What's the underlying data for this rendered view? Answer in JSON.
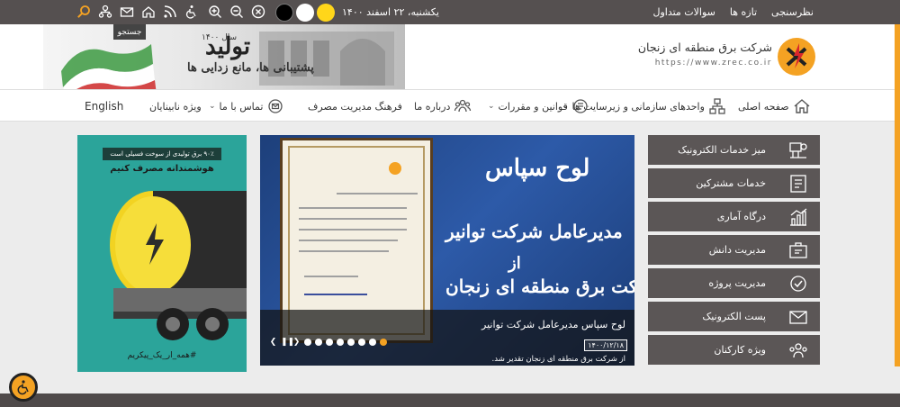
{
  "topbar": {
    "links": [
      "نظرسنجی",
      "تازه ها",
      "سوالات متداول"
    ],
    "date": "یکشنبه، ۲۲ اسفند ۱۴۰۰",
    "contrast_colors": [
      "#ffd61a",
      "#ffffff",
      "#000000"
    ]
  },
  "header": {
    "brand_title": "شرکت برق منطقه ای زنجان",
    "brand_url": "https://www.zrec.co.ir",
    "banner_title": "تولید",
    "banner_subtitle": "پشتیبانی ها، مانع زدایی ها",
    "banner_year": "سال ۱۴۰۰",
    "search_label": "جستجو"
  },
  "nav": {
    "home": "صفحه اصلی",
    "units": "واحدهای سازمانی و زیرسایت ها",
    "laws": "قوانین و مقررات",
    "about": "درباره ما",
    "culture": "فرهنگ مدیریت مصرف",
    "contact": "تماس با ما",
    "blind": "ویژه نابینایان",
    "english": "English"
  },
  "ad": {
    "badge": "۹۰٪ برق تولیدی از سوخت فسیلی است",
    "title": "هوشمندانه مصرف کنیم",
    "slogan": "#همه_ار_یک_پیکریم"
  },
  "slider": {
    "heading": "لوح سپاس",
    "line2": "مدیرعامل شرکت توانیر",
    "line3": "از",
    "line4": "شرکت برق منطقه ای زنجان",
    "caption_title": "لوح سپاس مدیرعامل شرکت توانیر",
    "caption_date": "۱۴۰۰/۱۲/۱۸",
    "caption_desc": "از شرکت برق منطقه ای زنجان تقدیر شد.",
    "total_slides": 8,
    "active_index": 0
  },
  "services": [
    {
      "label": "میز خدمات الکترونیک",
      "icon": "service-desk-icon"
    },
    {
      "label": "خدمات مشترکین",
      "icon": "customers-icon"
    },
    {
      "label": "درگاه آماری",
      "icon": "stats-chart-icon"
    },
    {
      "label": "مدیریت دانش",
      "icon": "knowledge-icon"
    },
    {
      "label": "مدیریت پروژه",
      "icon": "project-icon"
    },
    {
      "label": "پست الکترونیک",
      "icon": "email-icon"
    },
    {
      "label": "ویژه کارکنان",
      "icon": "staff-icon"
    }
  ],
  "colors": {
    "accent": "#f4a223",
    "dark_bar": "#555050",
    "service_bg": "#5b5656"
  }
}
